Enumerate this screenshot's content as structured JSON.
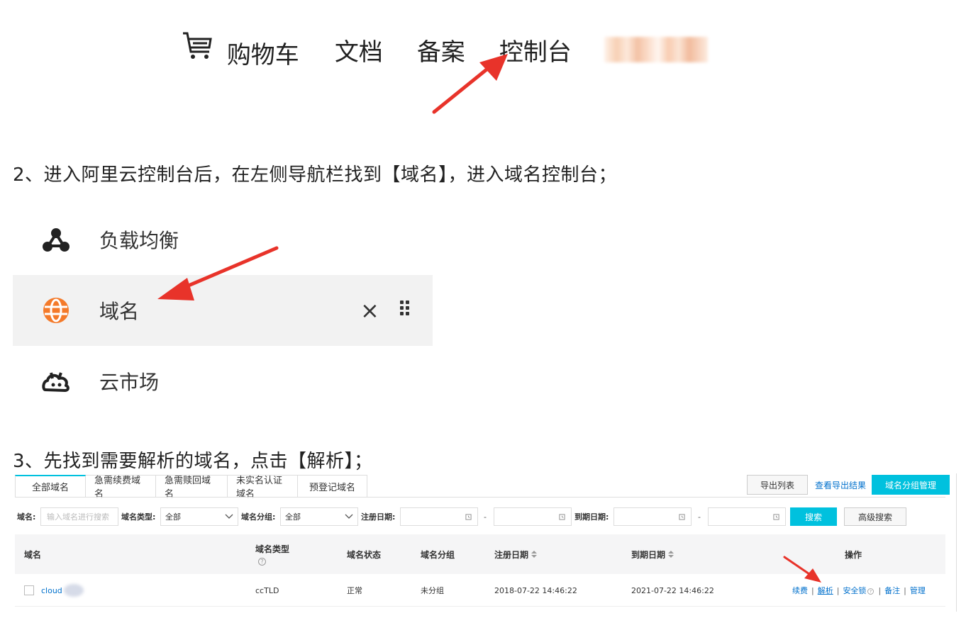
{
  "top_nav": {
    "cart": "购物车",
    "docs": "文档",
    "beian": "备案",
    "console": "控制台"
  },
  "steps": {
    "step2": "2、进入阿里云控制台后，在左侧导航栏找到【域名】，进入域名控制台；",
    "step3": "3、先找到需要解析的域名，点击【解析】；"
  },
  "side_menu": {
    "items": [
      {
        "label": "负载均衡",
        "icon": "load-balancer-icon"
      },
      {
        "label": "域名",
        "icon": "globe-icon",
        "active": true,
        "close": "×"
      },
      {
        "label": "云市场",
        "icon": "cloud-market-icon"
      }
    ]
  },
  "colors": {
    "accent": "#00c1de",
    "link": "#0070cc",
    "arrow": "#e8332a",
    "globe": "#f47a2a"
  },
  "domain_console": {
    "tabs": [
      "全部域名",
      "急需续费域名",
      "急需赎回域名",
      "未实名认证域名",
      "预登记域名"
    ],
    "actions": {
      "export_list": "导出列表",
      "view_export_results": "查看导出结果",
      "group_manage": "域名分组管理"
    },
    "filters": {
      "domain_label": "域名:",
      "domain_placeholder": "输入域名进行搜索",
      "type_label": "域名类型:",
      "type_value": "全部",
      "group_label": "域名分组:",
      "group_value": "全部",
      "reg_date_label": "注册日期:",
      "exp_date_label": "到期日期:",
      "range_sep": "-",
      "search_button": "搜索",
      "advanced_search_button": "高级搜索"
    },
    "table": {
      "headers": {
        "domain": "域名",
        "type": "域名类型",
        "status": "域名状态",
        "group": "域名分组",
        "reg_date": "注册日期",
        "exp_date": "到期日期",
        "ops": "操作"
      },
      "rows": [
        {
          "domain": "cloud",
          "type": "ccTLD",
          "status": "正常",
          "group": "未分组",
          "reg_date": "2018-07-22 14:46:22",
          "exp_date": "2021-07-22 14:46:22",
          "ops": {
            "renew": "续费",
            "resolve": "解析",
            "security_lock": "安全锁",
            "remark": "备注",
            "manage": "管理",
            "sep": "|"
          }
        }
      ]
    }
  }
}
